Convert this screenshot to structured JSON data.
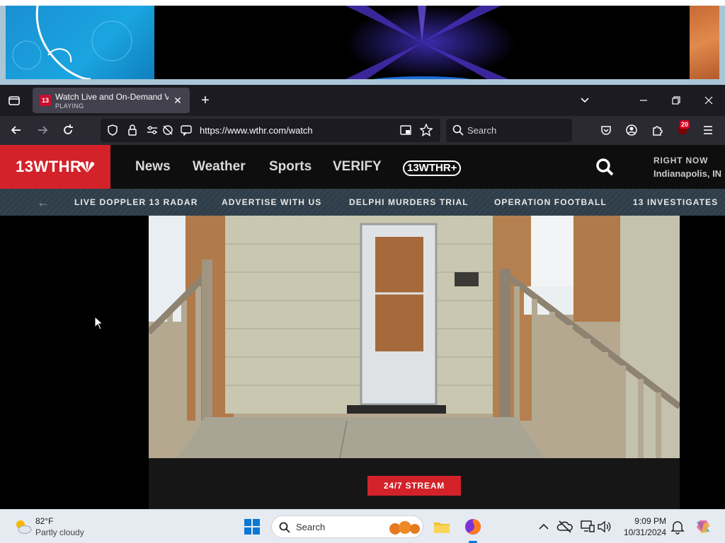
{
  "browser": {
    "tab": {
      "favicon": "13",
      "title": "Watch Live and On-Demand Vi",
      "status": "PLAYING"
    },
    "url": "https://www.wthr.com/watch",
    "search_placeholder": "Search",
    "extension_badge": "20"
  },
  "site": {
    "logo": "13WTHR",
    "menu": [
      "News",
      "Weather",
      "Sports",
      "VERIFY"
    ],
    "plus_logo": "13WTHR+",
    "right_now_label": "RIGHT NOW",
    "right_now_city": "Indianapolis, IN",
    "subnav": [
      "LIVE DOPPLER 13 RADAR",
      "ADVERTISE WITH US",
      "DELPHI MURDERS TRIAL",
      "OPERATION FOOTBALL",
      "13 INVESTIGATES"
    ],
    "stream_button": "24/7 STREAM"
  },
  "taskbar": {
    "weather_temp": "82°F",
    "weather_desc": "Partly cloudy",
    "search_placeholder": "Search",
    "time": "9:09 PM",
    "date": "10/31/2024"
  },
  "colors": {
    "brand_red": "#d3222a",
    "browser_dark": "#1c1b22",
    "toolbar": "#2b2a33"
  }
}
